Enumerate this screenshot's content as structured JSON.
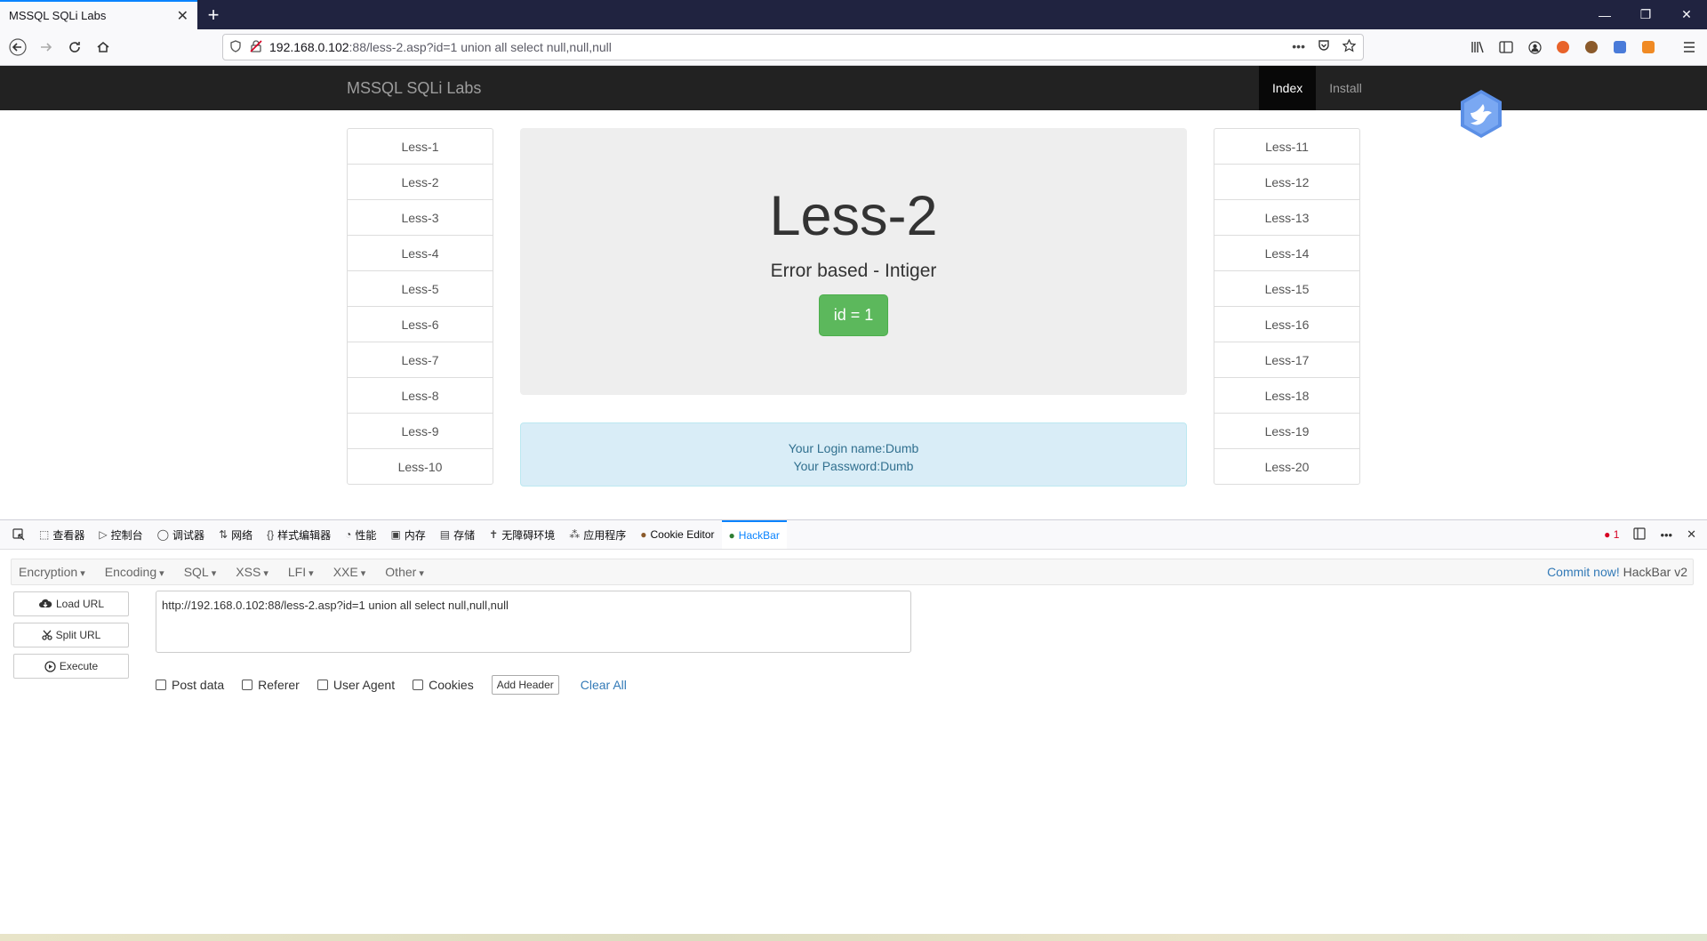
{
  "browser": {
    "tab_title": "MSSQL SQLi Labs",
    "tab_close": "✕",
    "new_tab": "+",
    "window_controls": [
      "—",
      "❐",
      "✕"
    ],
    "url_host": "192.168.0.102",
    "url_rest": ":88/less-2.asp?id=1 union all select null,null,null",
    "url_more": "•••"
  },
  "site": {
    "brand": "MSSQL SQLi Labs",
    "nav": [
      {
        "label": "Index",
        "active": true
      },
      {
        "label": "Install",
        "active": false
      }
    ],
    "left_list": [
      "Less-1",
      "Less-2",
      "Less-3",
      "Less-4",
      "Less-5",
      "Less-6",
      "Less-7",
      "Less-8",
      "Less-9",
      "Less-10"
    ],
    "right_list": [
      "Less-11",
      "Less-12",
      "Less-13",
      "Less-14",
      "Less-15",
      "Less-16",
      "Less-17",
      "Less-18",
      "Less-19",
      "Less-20"
    ],
    "jumbotron": {
      "title": "Less-2",
      "subtitle": "Error based - Intiger",
      "button": "id = 1"
    },
    "alert": {
      "line1": "Your Login name:Dumb",
      "line2": "Your Password:Dumb"
    }
  },
  "devtools": {
    "tabs": [
      {
        "icon": "⬚",
        "label": "查看器"
      },
      {
        "icon": "▷",
        "label": "控制台"
      },
      {
        "icon": "◯",
        "label": "调试器"
      },
      {
        "icon": "⇅",
        "label": "网络"
      },
      {
        "icon": "{}",
        "label": "样式编辑器"
      },
      {
        "icon": "◔",
        "label": "性能"
      },
      {
        "icon": "▣",
        "label": "内存"
      },
      {
        "icon": "▤",
        "label": "存储"
      },
      {
        "icon": "✝",
        "label": "无障碍环境"
      },
      {
        "icon": "⁂",
        "label": "应用程序"
      },
      {
        "icon": "●",
        "label": "Cookie Editor"
      },
      {
        "icon": "●",
        "label": "HackBar"
      }
    ],
    "error_count": "1",
    "hackbar": {
      "menus": [
        "Encryption",
        "Encoding",
        "SQL",
        "XSS",
        "LFI",
        "XXE",
        "Other"
      ],
      "commit_text": "Commit now!",
      "version_text": "HackBar v2",
      "buttons": {
        "load": "Load URL",
        "split": "Split URL",
        "execute": "Execute"
      },
      "url_value": "http://192.168.0.102:88/less-2.asp?id=1 union all select null,null,null",
      "options": {
        "post": "Post data",
        "referer": "Referer",
        "ua": "User Agent",
        "cookies": "Cookies"
      },
      "add_header": "Add Header",
      "clear_all": "Clear All"
    }
  }
}
